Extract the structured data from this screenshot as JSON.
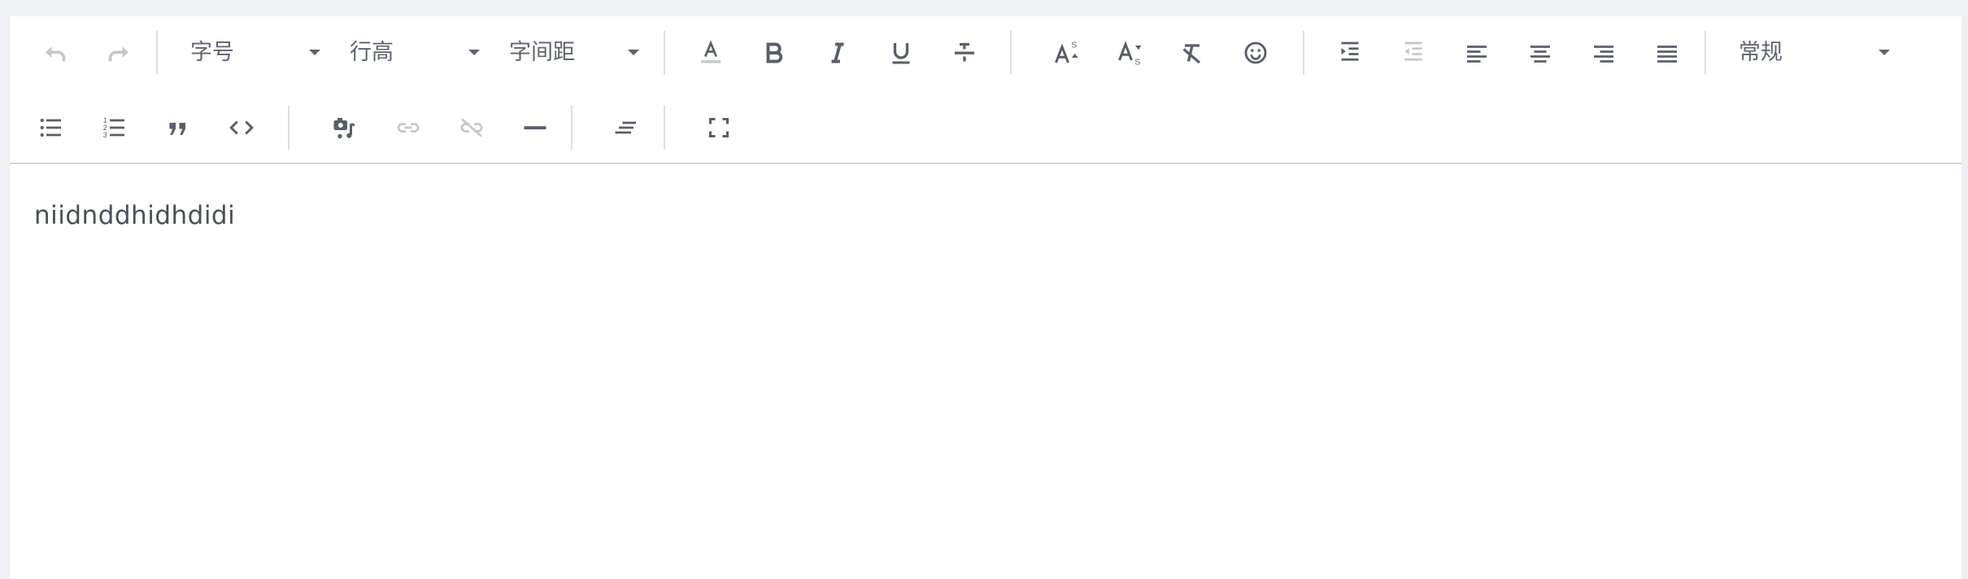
{
  "toolbar": {
    "font_size_label": "字号",
    "line_height_label": "行高",
    "letter_spacing_label": "字间距",
    "paragraph_style_label": "常规",
    "icons": {
      "undo": "undo-icon",
      "redo": "redo-icon",
      "font_color": "font-color-icon",
      "bold": "bold-icon",
      "italic": "italic-icon",
      "underline": "underline-icon",
      "strikethrough": "strikethrough-icon",
      "superscript": "superscript-icon",
      "subscript": "subscript-icon",
      "clear_format": "clear-format-icon",
      "emoji": "emoji-icon",
      "indent": "indent-icon",
      "outdent": "outdent-icon",
      "align_left": "align-left-icon",
      "align_center": "align-center-icon",
      "align_right": "align-right-icon",
      "align_justify": "align-justify-icon",
      "bullet_list": "bullet-list-icon",
      "numbered_list": "numbered-list-icon",
      "blockquote": "blockquote-icon",
      "code": "code-icon",
      "media": "media-icon",
      "link": "link-icon",
      "unlink": "unlink-icon",
      "horizontal_rule": "horizontal-rule-icon",
      "text_indent": "text-indent-icon",
      "fullscreen": "fullscreen-icon"
    }
  },
  "content": {
    "text": "niidnddhidhdidi"
  },
  "colors": {
    "page_background": "#eef0f3",
    "editor_background": "#ffffff",
    "icon": "#595e6b",
    "separator": "#dcdee3"
  }
}
